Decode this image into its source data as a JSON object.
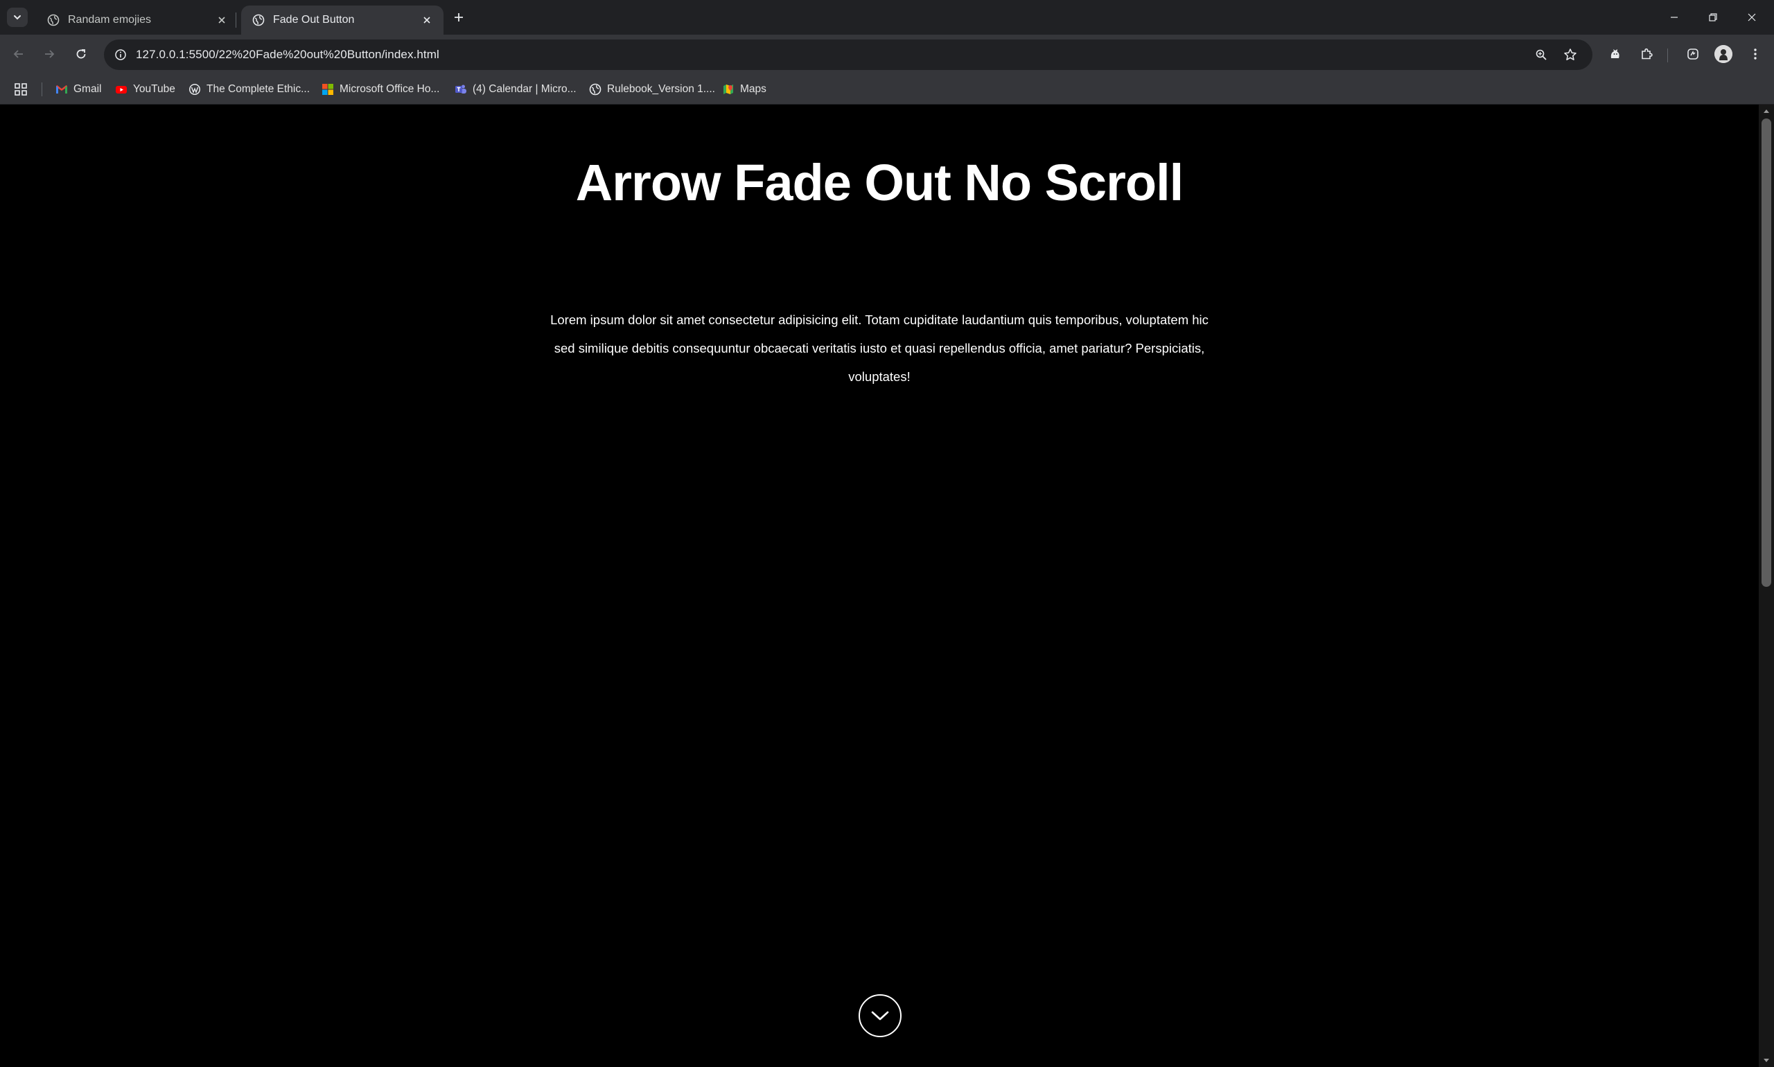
{
  "tabs": [
    {
      "title": "Randam emojies",
      "active": false
    },
    {
      "title": "Fade Out Button",
      "active": true
    }
  ],
  "address_bar": {
    "url": "127.0.0.1:5500/22%20Fade%20out%20Button/index.html"
  },
  "bookmarks": [
    {
      "label": "Gmail",
      "icon": "gmail-icon"
    },
    {
      "label": "YouTube",
      "icon": "youtube-icon"
    },
    {
      "label": "The Complete Ethic...",
      "icon": "wordpress-icon"
    },
    {
      "label": "Microsoft Office Ho...",
      "icon": "microsoft-icon"
    },
    {
      "label": "(4) Calendar | Micro...",
      "icon": "teams-icon"
    },
    {
      "label": "Rulebook_Version 1....",
      "icon": "globe-icon"
    },
    {
      "label": "Maps",
      "icon": "maps-icon"
    }
  ],
  "page": {
    "title": "Arrow Fade Out No Scroll",
    "paragraph": "Lorem ipsum dolor sit amet consectetur adipisicing elit. Totam cupiditate laudantium quis temporibus, voluptatem hic sed similique debitis consequuntur obcaecati veritatis iusto et quasi repellendus officia, amet pariatur? Perspiciatis, voluptates!"
  },
  "colors": {
    "page_background": "#000000",
    "tab_strip": "#202124",
    "toolbar": "#35363a",
    "text": "#ffffff"
  }
}
